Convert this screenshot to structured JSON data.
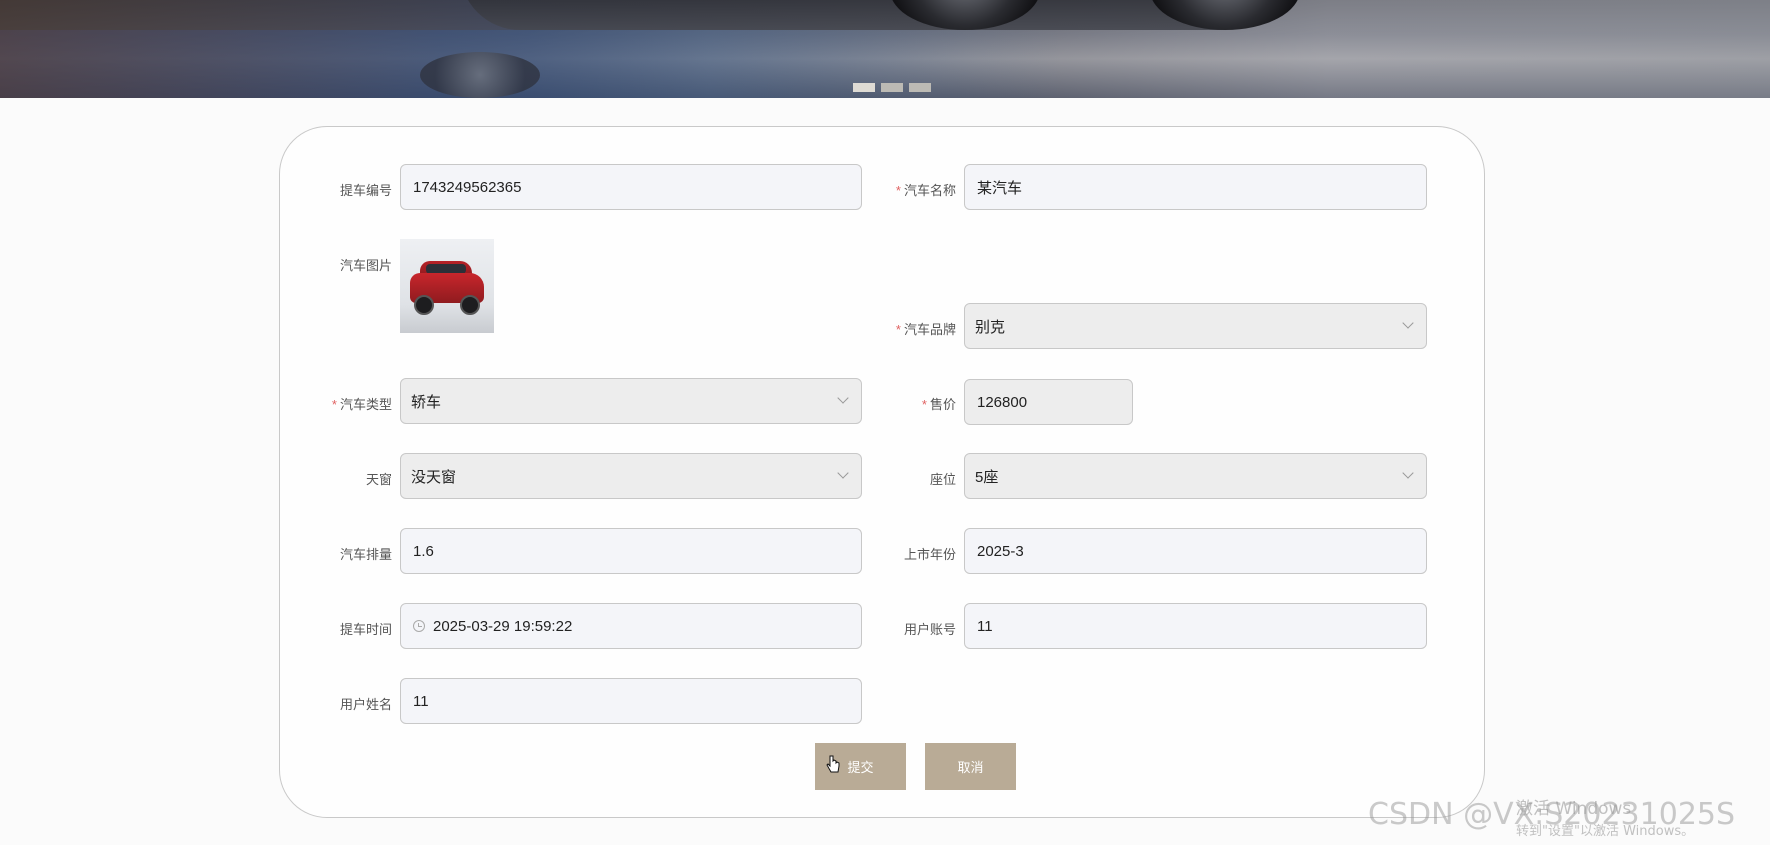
{
  "banner": {
    "carousel_dots": 3,
    "active_dot": 0
  },
  "form": {
    "pickup_no": {
      "label": "提车编号",
      "value": "1743249562365",
      "required": false
    },
    "car_name": {
      "label": "汽车名称",
      "value": "某汽车",
      "required": true
    },
    "car_image": {
      "label": "汽车图片",
      "required": false
    },
    "car_brand": {
      "label": "汽车品牌",
      "value": "别克",
      "required": true
    },
    "car_type": {
      "label": "汽车类型",
      "value": "轿车",
      "required": true
    },
    "price": {
      "label": "售价",
      "value": "126800",
      "required": true
    },
    "sunroof": {
      "label": "天窗",
      "value": "没天窗",
      "required": false
    },
    "seats": {
      "label": "座位",
      "value": "5座",
      "required": false
    },
    "displacement": {
      "label": "汽车排量",
      "value": "1.6",
      "required": false
    },
    "launch_year": {
      "label": "上市年份",
      "value": "2025-3",
      "required": false
    },
    "pickup_time": {
      "label": "提车时间",
      "value": "2025-03-29 19:59:22",
      "required": false
    },
    "user_account": {
      "label": "用户账号",
      "value": "11",
      "required": false
    },
    "user_name": {
      "label": "用户姓名",
      "value": "11",
      "required": false
    },
    "required_mark": "*"
  },
  "buttons": {
    "submit": "提交",
    "cancel": "取消"
  },
  "overlay": {
    "windows_activate_title": "激活 Windows",
    "windows_activate_sub": "转到\"设置\"以激活 Windows。",
    "csdn_watermark": "CSDN @VX:S20231025S"
  },
  "colors": {
    "button": "#b9ab96",
    "required": "#e06262",
    "field_bg": "#f4f5f9",
    "select_bg": "#ededed"
  }
}
